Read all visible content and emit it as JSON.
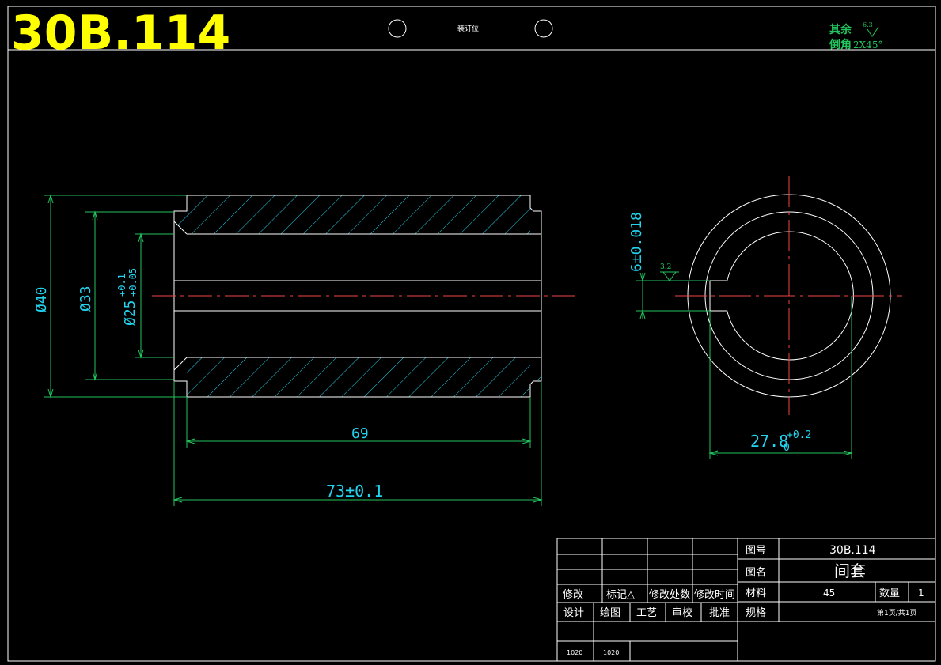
{
  "header": {
    "drawing_no": "30B.114",
    "binding_label": "装订位"
  },
  "notes": {
    "roughness_rest_label": "其余",
    "roughness_rest_value": "6.3",
    "chamfer_label": "倒角",
    "chamfer_value": "2X45°"
  },
  "dimensions": {
    "outer_dia": "Ø40",
    "step_dia": "Ø33",
    "bore_dia": "Ø25",
    "bore_tol_upper": "+0.1",
    "bore_tol_lower": "+0.05",
    "length_inner": "69",
    "length_total": "73±0.1",
    "key_width": "6±0.018",
    "key_roughness": "3.2",
    "key_depth": "27.8",
    "key_depth_tol_upper": "+0.2",
    "key_depth_tol_lower": "0"
  },
  "title_block": {
    "rev_headers": [
      "修改",
      "标记△",
      "修改处数",
      "修改时间"
    ],
    "sign_headers": [
      "设计",
      "绘图",
      "工艺",
      "审校",
      "批准"
    ],
    "sign_dates": [
      "1020",
      "1020"
    ],
    "drawing_no_label": "图号",
    "drawing_no_value": "30B.114",
    "name_label": "图名",
    "name_value": "间套",
    "material_label": "材料",
    "material_value": "45",
    "quantity_label": "数量",
    "quantity_value": "1",
    "spec_label": "规格",
    "page_info": "第1页/共1页"
  },
  "colors": {
    "background": "#000000",
    "outline": "#ffffff",
    "dimension": "#22c55e",
    "dimension_text": "#22d3ee",
    "hatch": "#22d3ee",
    "centerline": "#ef4444",
    "title_text": "#ffff00"
  }
}
